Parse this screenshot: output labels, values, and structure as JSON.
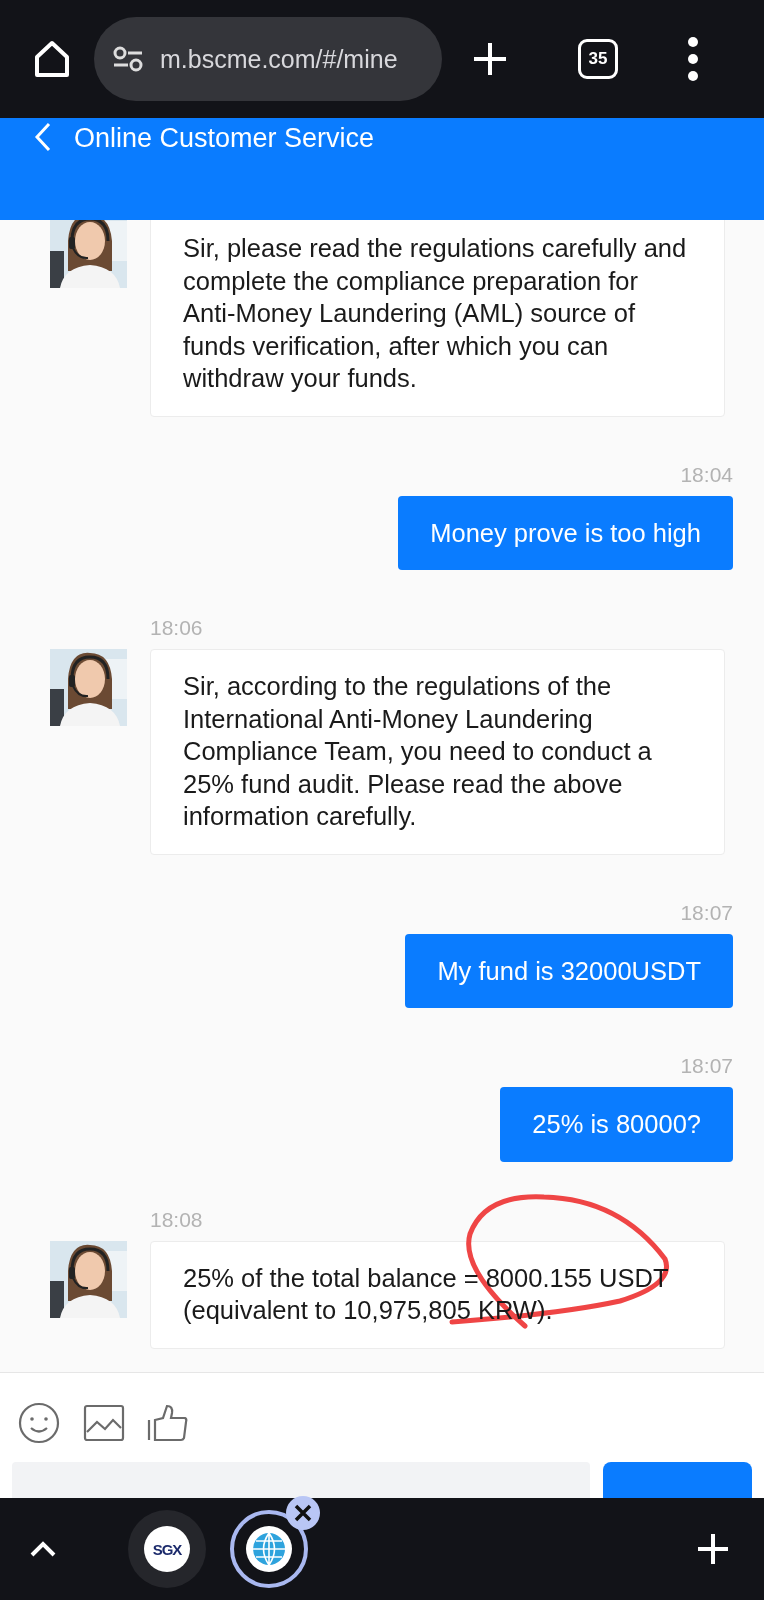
{
  "browser": {
    "url": "m.bscme.com/#/mine",
    "tab_count": "35"
  },
  "header": {
    "title": "Online Customer Service"
  },
  "messages": [
    {
      "kind": "agent",
      "text": "Sir, please read the regulations carefully and complete the compliance preparation for Anti-Money Laundering (AML) source of funds verification, after which you can withdraw your funds.",
      "circled": false
    },
    {
      "kind": "user",
      "time": "18:04",
      "text": "Money prove is too high",
      "circled": false
    },
    {
      "kind": "agent",
      "time": "18:06",
      "text": "Sir, according to the regulations of the International Anti-Money Laundering Compliance Team, you need to conduct a 25% fund audit. Please read the above information carefully.",
      "circled": false
    },
    {
      "kind": "user",
      "time": "18:07",
      "text": "My fund is 32000USDT",
      "circled": false
    },
    {
      "kind": "user",
      "time": "18:07",
      "text": "25% is 80000?",
      "circled": false
    },
    {
      "kind": "agent",
      "time": "18:08",
      "text": "25% of the total balance = 8000.155 USDT (equivalent to 10,975,805 KRW).",
      "circled": true
    }
  ],
  "tabs": [
    {
      "logo": "SGX",
      "kind": "sgx",
      "selected": false
    },
    {
      "kind": "globe",
      "selected": true
    }
  ]
}
